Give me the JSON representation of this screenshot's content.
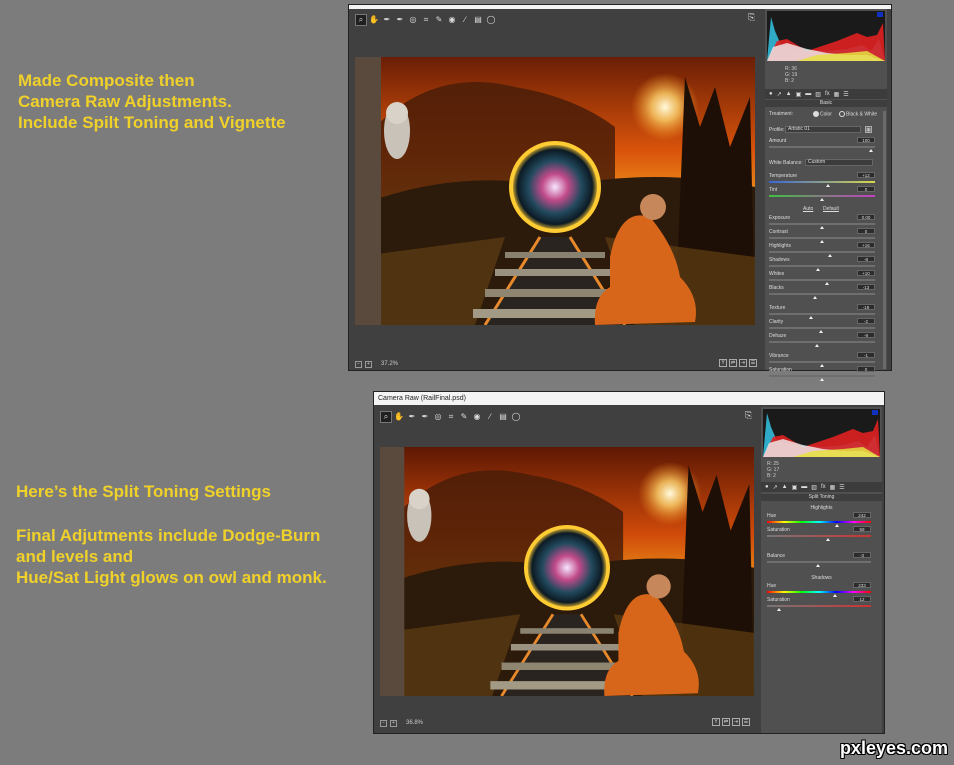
{
  "notes": {
    "top": "Made Composite then\nCamera Raw Adjustments.\nInclude Spilt Toning and Vignette",
    "split": "Here’s the Split Toning Settings",
    "final": "Final Adjutments include Dodge-Burn\nand levels and\nHue/Sat Light glows on owl and monk."
  },
  "window1": {
    "zoom": "37.2%",
    "rgb": {
      "r": "R: 36",
      "g": "G: 19",
      "b": "B: 2"
    },
    "section": "Basic",
    "treatment": {
      "label": "Treatment:",
      "color": "Color",
      "bw": "Black & White"
    },
    "profile": {
      "label": "Profile:",
      "value": "Artistic 01"
    },
    "amount": {
      "label": "Amount",
      "value": "100",
      "level": 1.0
    },
    "white_balance": {
      "label": "White Balance:",
      "value": "Custom"
    },
    "links": {
      "auto": "Auto",
      "default": "Default"
    },
    "sliders": [
      {
        "label": "Temperature",
        "value": "+12",
        "level": 0.56,
        "kind": "temp"
      },
      {
        "label": "Tint",
        "value": "0",
        "level": 0.5,
        "kind": "tint"
      },
      {
        "label": "Exposure",
        "value": "0.00",
        "level": 0.5,
        "kind": "plain"
      },
      {
        "label": "Contrast",
        "value": "0",
        "level": 0.5,
        "kind": "plain"
      },
      {
        "label": "Highlights",
        "value": "+16",
        "level": 0.58,
        "kind": "plain"
      },
      {
        "label": "Shadows",
        "value": "-8",
        "level": 0.46,
        "kind": "plain"
      },
      {
        "label": "Whites",
        "value": "+10",
        "level": 0.55,
        "kind": "plain"
      },
      {
        "label": "Blacks",
        "value": "-13",
        "level": 0.43,
        "kind": "plain"
      },
      {
        "label": "Texture",
        "value": "-19",
        "level": 0.4,
        "kind": "plain"
      },
      {
        "label": "Clarity",
        "value": "-2",
        "level": 0.49,
        "kind": "plain"
      },
      {
        "label": "Dehaze",
        "value": "-9",
        "level": 0.45,
        "kind": "plain"
      },
      {
        "label": "Vibrance",
        "value": "-1",
        "level": 0.5,
        "kind": "plain"
      },
      {
        "label": "Saturation",
        "value": "0",
        "level": 0.5,
        "kind": "plain"
      }
    ]
  },
  "window2": {
    "title": "Camera Raw (RailFinal.psd)",
    "zoom": "36.8%",
    "rgb": {
      "r": "R: 25",
      "g": "G: 17",
      "b": "B: 2"
    },
    "section": "Split Toning",
    "highlights": {
      "header": "Highlights",
      "hue_label": "Hue",
      "hue": "242",
      "hue_level": 0.67,
      "sat_label": "Saturation",
      "sat": "59",
      "sat_level": 0.59
    },
    "balance": {
      "label": "Balance",
      "value": "-3",
      "level": 0.49
    },
    "shadows": {
      "header": "Shadows",
      "hue_label": "Hue",
      "hue": "233",
      "hue_level": 0.65,
      "sat_label": "Saturation",
      "sat": "12",
      "sat_level": 0.12
    }
  },
  "watermark": "pxleyes.com",
  "colors": {
    "note": "#f0d12a",
    "bg": "#7c7c7c"
  }
}
